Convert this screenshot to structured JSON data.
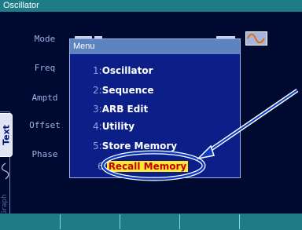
{
  "window": {
    "title": "Oscillator"
  },
  "params": [
    {
      "label": "Mode"
    },
    {
      "label": "Freq"
    },
    {
      "label": "Amptd"
    },
    {
      "label": "Offset"
    },
    {
      "label": "Phase"
    }
  ],
  "side_tabs": {
    "text": "Text",
    "graph": "Graph"
  },
  "waveform_icon": "sine-wave-icon",
  "menu": {
    "title": "Menu",
    "items": [
      {
        "number": "1:",
        "label": "Oscillator"
      },
      {
        "number": "2:",
        "label": "Sequence"
      },
      {
        "number": "3:",
        "label": "ARB Edit"
      },
      {
        "number": "4:",
        "label": "Utility"
      },
      {
        "number": "5:",
        "label": "Store Memory"
      },
      {
        "number": "6:",
        "label": "Recall Memory",
        "selected": true
      }
    ]
  },
  "colors": {
    "title_bar": "#1e7c87",
    "screen_background": "#000a30",
    "menu_background": "#0c1f88",
    "menu_title_bar": "#5d83c0",
    "highlight_background": "#ffe830",
    "highlight_text": "#c40000",
    "callout": "#0a3cc8"
  }
}
